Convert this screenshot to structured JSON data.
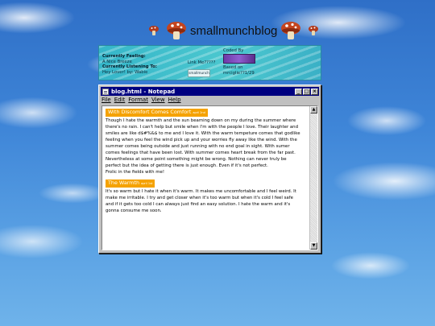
{
  "site": {
    "title": "smallmunchblog"
  },
  "info": {
    "feeling_label": "Currently Feeling:",
    "feeling_value": "A Nice Breeze",
    "listening_label": "Currently Listening To:",
    "listening_value": "Hey Lover! by: Wabie",
    "link_me": "Link Me?????",
    "link_button": "smallmunch",
    "coded_by": "Coded By",
    "based_on_label": "Based on",
    "based_on_value": "mrciglie??1/29"
  },
  "window": {
    "title": "blog.html - Notepad",
    "menu": [
      "File",
      "Edit",
      "Format",
      "View",
      "Help"
    ],
    "minimize": "_",
    "maximize": "□",
    "close": "×"
  },
  "posts": [
    {
      "title": "With Discomfort Comes Comfort",
      "date": "april 2nd",
      "body": "Though I hate the warmth and the sun beaming down on my during the summer where there's no rain. I can't help but smile when I'm with the people I love. Their laughter and smiles are like d$#%&$ to me and I love it. With the warm tempeture comes that godlike feeling when you feel the wind pick up and your worries fly away like the wind. With the summer comes being outside and just running with no end goal in sight. With sumer comes feelings that have been lost. With summer comes heart break from the far past. Nevertheless at some point something might be wrong. Nothing can never truly be perfect but the idea of getting there is just enough. Even if it's not perfect.",
      "closing": "Frolic in the fields with me!"
    },
    {
      "title": "The Warmth",
      "date": "april 1st",
      "body": "It's so warm but I hate it when it's warm. It makes me uncomfortable and I feel weird. It make me irritable. I try and get closer when it's too warm but when it's cold I feel safe and if it gets too cold I can always just find an easy solution. I hate the warm and it's gonna consume me soon.",
      "closing": ""
    }
  ],
  "colors": {
    "titlebar": "#000080",
    "post_title_bg": "#f5a200",
    "panel": "#4cc8cf"
  }
}
